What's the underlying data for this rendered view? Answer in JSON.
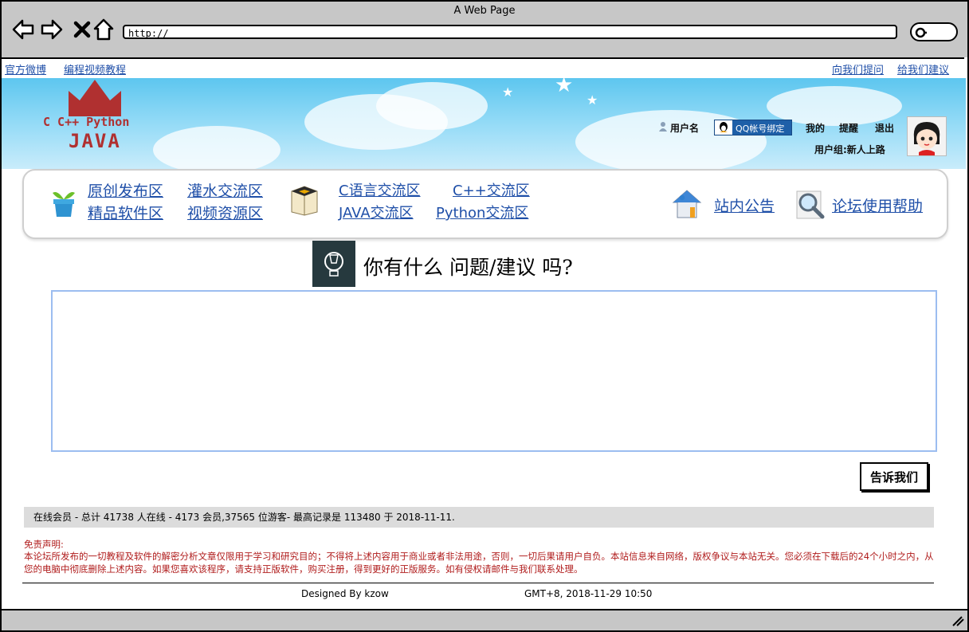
{
  "window": {
    "title": "A Web Page",
    "url": "http://"
  },
  "topbar": {
    "left_links": [
      "官方微博",
      "编程视频教程"
    ],
    "right_links": [
      "向我们提问",
      "给我们建议"
    ]
  },
  "logo": {
    "line1": "C C++ Python",
    "line2": "JAVA",
    "color": "#b03030"
  },
  "user": {
    "username": "用户名",
    "qq_bind": "QQ帐号绑定",
    "my": "我的",
    "remind": "提醒",
    "logout": "退出",
    "group": "用户组:新人上路"
  },
  "nav": {
    "group1": [
      "原创发布区",
      "灌水交流区",
      "精品软件区",
      "视频资源区"
    ],
    "group2": [
      "C语言交流区",
      "C++交流区",
      "JAVA交流区",
      "Python交流区"
    ],
    "announce": "站内公告",
    "help": "论坛使用帮助"
  },
  "ask": {
    "title": "你有什么 问题/建议 吗?",
    "submit_label": "告诉我们",
    "textarea_value": ""
  },
  "stats": {
    "text": "在线会员 - 总计 41738 人在线 - 4173 会员,37565 位游客- 最高记录是 113480 于 2018-11-11."
  },
  "disclaimer": {
    "title": "免责声明:",
    "body": "本论坛所发布的一切教程及软件的解密分析文章仅限用于学习和研究目的；不得将上述内容用于商业或者非法用途，否则，一切后果请用户自负。本站信息来自网络，版权争议与本站无关。您必须在下载后的24个小时之内，从您的电脑中彻底删除上述内容。如果您喜欢该程序，请支持正版软件，购买注册，得到更好的正版服务。如有侵权请邮件与我们联系处理。"
  },
  "footer": {
    "designed_by": "Designed By kzow",
    "time": "GMT+8, 2018-11-29 10:50"
  },
  "colors": {
    "link": "#1f4fa8",
    "disclaimer": "#b01c1c",
    "chrome": "#c7c7c7",
    "textarea_border": "#9cbdf0"
  },
  "icons": [
    "back-arrow-icon",
    "forward-arrow-icon",
    "close-x-icon",
    "home-icon",
    "search-icon",
    "user-icon",
    "qq-penguin-icon",
    "avatar",
    "plant-pot-icon",
    "box-icon",
    "house-icon",
    "magnifier-icon",
    "lightbulb-icon",
    "resize-grip-icon"
  ]
}
